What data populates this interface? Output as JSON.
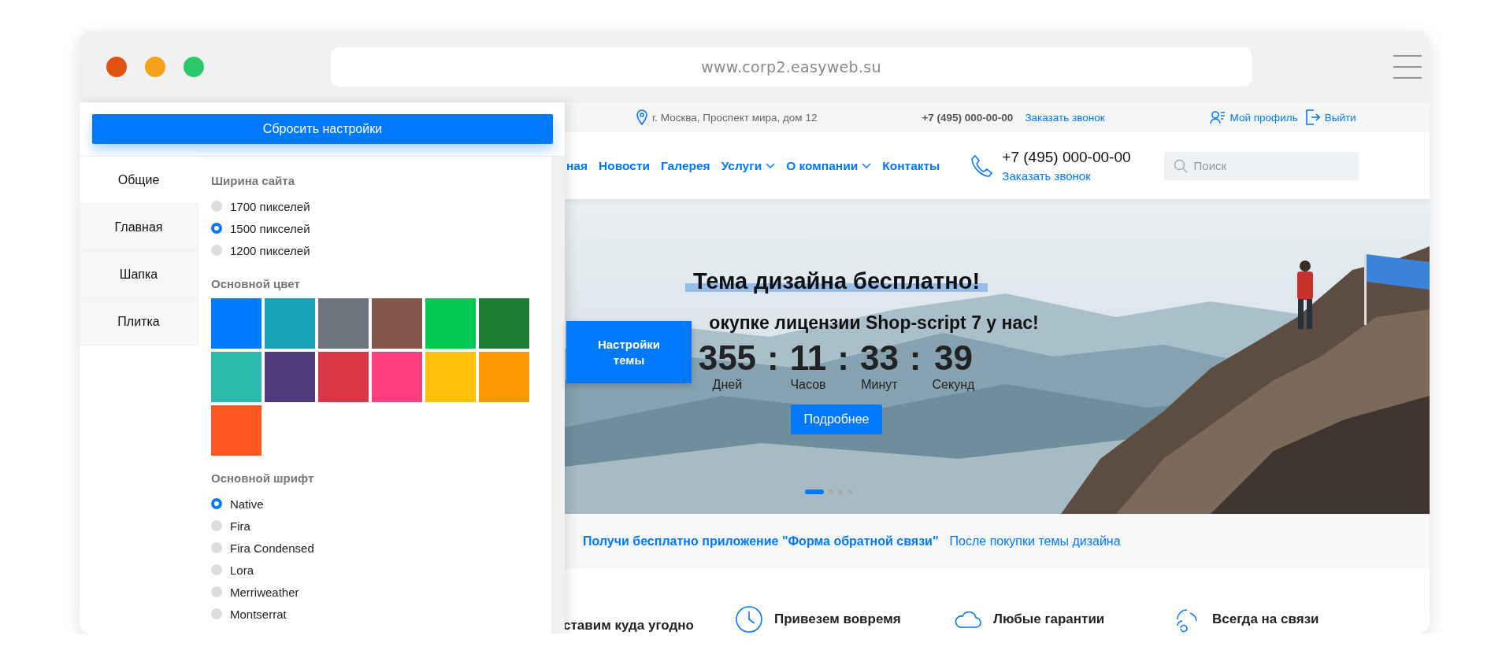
{
  "browser": {
    "url": "www.corp2.easyweb.su"
  },
  "settings_panel": {
    "reset_button": "Сбросить настройки",
    "tabs": [
      {
        "label": "Общие",
        "selected": true
      },
      {
        "label": "Главная",
        "selected": false
      },
      {
        "label": "Шапка",
        "selected": false
      },
      {
        "label": "Плитка",
        "selected": false
      }
    ],
    "sections": [
      {
        "kind": "radio",
        "title": "Ширина сайта",
        "options": [
          {
            "label": "1700 пикселей",
            "selected": false
          },
          {
            "label": "1500 пикселей",
            "selected": true
          },
          {
            "label": "1200 пикселей",
            "selected": false
          }
        ]
      },
      {
        "kind": "colors",
        "title": "Основной цвет",
        "swatches": [
          {
            "color": "#007bff"
          },
          {
            "color": "#17a2b8"
          },
          {
            "color": "#6c757d"
          },
          {
            "color": "#82574a"
          },
          {
            "color": "#00c851"
          },
          {
            "color": "#1e7e34"
          },
          {
            "color": "#2bbbad"
          },
          {
            "color": "#4f3a7c"
          },
          {
            "color": "#dc3545"
          },
          {
            "color": "#ff3d7f"
          },
          {
            "color": "#ffc107"
          },
          {
            "color": "#ff9800"
          },
          {
            "color": "#ff5722"
          }
        ]
      },
      {
        "kind": "radio",
        "title": "Основной шрифт",
        "options": [
          {
            "label": "Native",
            "selected": true
          },
          {
            "label": "Fira",
            "selected": false
          },
          {
            "label": "Fira Condensed",
            "selected": false
          },
          {
            "label": "Lora",
            "selected": false
          },
          {
            "label": "Merriweather",
            "selected": false
          },
          {
            "label": "Montserrat",
            "selected": false
          }
        ]
      }
    ]
  },
  "theme_settings_tab": "Настройки темы",
  "topbar": {
    "address": "г. Москва, Проспект мира, дом 12",
    "phone": "+7 (495) 000-00-00",
    "callback": "Заказать звонок",
    "profile": "Мой профиль",
    "logout": "Выйти"
  },
  "header": {
    "nav": [
      {
        "label": "ная",
        "dropdown": false
      },
      {
        "label": "Новости",
        "dropdown": false
      },
      {
        "label": "Галерея",
        "dropdown": false
      },
      {
        "label": "Услуги",
        "dropdown": true
      },
      {
        "label": "О компании",
        "dropdown": true
      },
      {
        "label": "Контакты",
        "dropdown": false
      }
    ],
    "phone": "+7 (495) 000-00-00",
    "callback": "Заказать звонок",
    "search": {
      "placeholder": "Поиск"
    }
  },
  "hero": {
    "title": "Тема дизайна бесплатно!",
    "subtitle": "окупке лицензии Shop-script 7 у нас!",
    "countdown": [
      {
        "value": "355",
        "unit": "Дней"
      },
      {
        "value": "11",
        "unit": "Часов"
      },
      {
        "value": "33",
        "unit": "Минут"
      },
      {
        "value": "39",
        "unit": "Секунд"
      }
    ],
    "separator": ":",
    "button": "Подробнее",
    "dots": [
      {
        "selected": true
      },
      {
        "selected": false
      },
      {
        "selected": false
      },
      {
        "selected": false
      }
    ]
  },
  "promo": {
    "title": "Получи бесплатно приложение \"Форма обратной связи\"",
    "text": "После покупки темы дизайна"
  },
  "features": [
    {
      "label": "ставим куда угодно"
    },
    {
      "label": "Привезем вовремя"
    },
    {
      "label": "Любые гарантии"
    },
    {
      "label": "Всегда на связи"
    }
  ]
}
